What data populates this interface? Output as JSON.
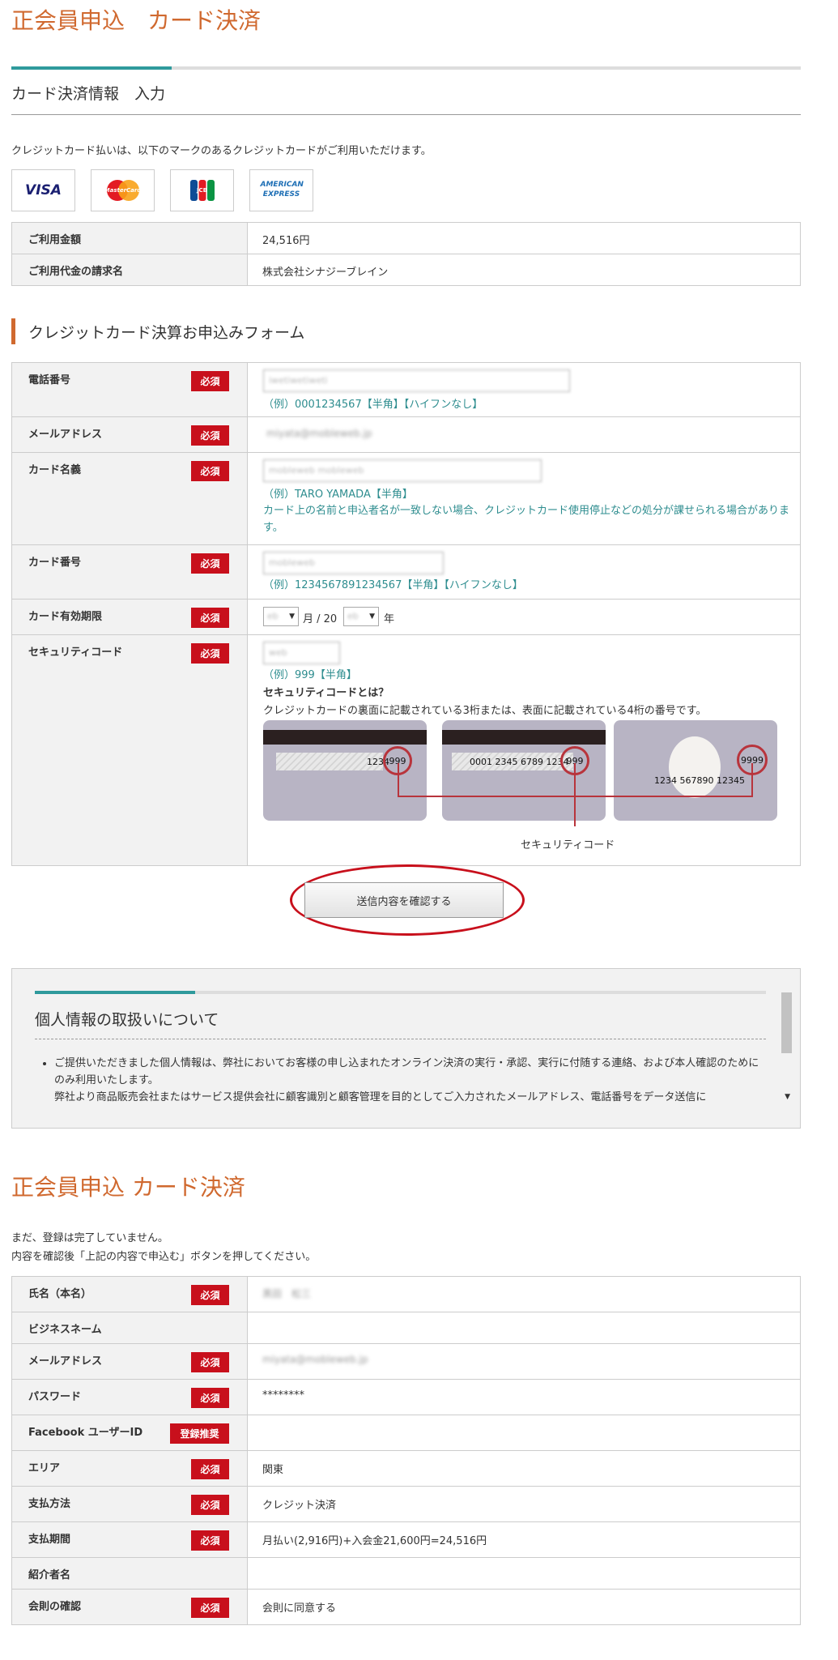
{
  "page_title": "正会員申込　カード決済",
  "section_title": "カード決済情報　入力",
  "intro": "クレジットカード払いは、以下のマークのあるクレジットカードがご利用いただけます。",
  "card_brands": [
    "VISA",
    "MasterCard",
    "JCB",
    "AMERICAN EXPRESS"
  ],
  "summary": [
    {
      "label": "ご利用金額",
      "value": "24,516円"
    },
    {
      "label": "ご利用代金の請求名",
      "value": "株式会社シナジーブレイン"
    }
  ],
  "form_title": "クレジットカード決算お申込みフォーム",
  "required_badge": "必須",
  "recommended_badge": "登録推奨",
  "form": {
    "phone": {
      "label": "電話番号",
      "value": "iwetiwetiweti",
      "hint": "（例）0001234567【半角】【ハイフンなし】"
    },
    "email": {
      "label": "メールアドレス",
      "value": "miyata@mobleweb.jp"
    },
    "card_name": {
      "label": "カード名義",
      "value": "mobleweb mobleweb",
      "hint": "（例）TARO YAMADA【半角】",
      "note": "カード上の名前と申込者名が一致しない場合、クレジットカード使用停止などの処分が課せられる場合があります。"
    },
    "card_number": {
      "label": "カード番号",
      "value": "mobleweb",
      "hint": "（例）1234567891234567【半角】【ハイフンなし】"
    },
    "expiry": {
      "label": "カード有効期限",
      "month": "eb",
      "month_unit": "月 / 20",
      "year": "eb",
      "year_unit": "年"
    },
    "security": {
      "label": "セキュリティコード",
      "value": "web",
      "hint": "（例）999【半角】",
      "title": "セキュリティコードとは？",
      "desc": "クレジットカードの裏面に記載されている3桁または、表面に記載されている4桁の番号です。",
      "diagram_label": "セキュリティコード"
    }
  },
  "cards_diagram": {
    "card1": {
      "sig": "1234",
      "code": "999"
    },
    "card2": {
      "sig": "0001  2345  6789  1234",
      "code": "999"
    },
    "card3": {
      "num": "1234  567890  12345",
      "code": "9999"
    }
  },
  "confirm_button": "送信内容を確認する",
  "privacy": {
    "title": "個人情報の取扱いについて",
    "items": [
      "ご提供いただきました個人情報は、弊社においてお客様の申し込まれたオンライン決済の実行・承認、実行に付随する連絡、および本人確認のためにのみ利用いたします。",
      "弊社より商品販売会社またはサービス提供会社に顧客識別と顧客管理を目的としてご入力されたメールアドレス、電話番号をデータ送信に"
    ]
  },
  "page_title2": "正会員申込 カード決済",
  "notice": [
    "まだ、登録は完了していません。",
    "内容を確認後「上記の内容で申込む」ボタンを押してください。"
  ],
  "confirm_rows": [
    {
      "label": "氏名（本名）",
      "badge": "req",
      "value": "黒田　松三",
      "blur": true
    },
    {
      "label": "ビジネスネーム",
      "badge": "",
      "value": "",
      "blur": false
    },
    {
      "label": "メールアドレス",
      "badge": "req",
      "value": "miyata@mobleweb.jp",
      "blur": true
    },
    {
      "label": "パスワード",
      "badge": "req",
      "value": "********",
      "blur": false
    },
    {
      "label": "Facebook ユーザーID",
      "badge": "rec",
      "value": "",
      "blur": false
    },
    {
      "label": "エリア",
      "badge": "req",
      "value": "関東",
      "blur": false
    },
    {
      "label": "支払方法",
      "badge": "req",
      "value": "クレジット決済",
      "blur": false
    },
    {
      "label": "支払期間",
      "badge": "req",
      "value": "月払い(2,916円)+入会金21,600円=24,516円",
      "blur": false
    },
    {
      "label": "紹介者名",
      "badge": "",
      "value": "",
      "blur": false
    },
    {
      "label": "会則の確認",
      "badge": "req",
      "value": "会則に同意する",
      "blur": false
    }
  ],
  "colors": {
    "accent": "#d0692f",
    "teal": "#2f9a9c",
    "required": "#c8101c"
  }
}
